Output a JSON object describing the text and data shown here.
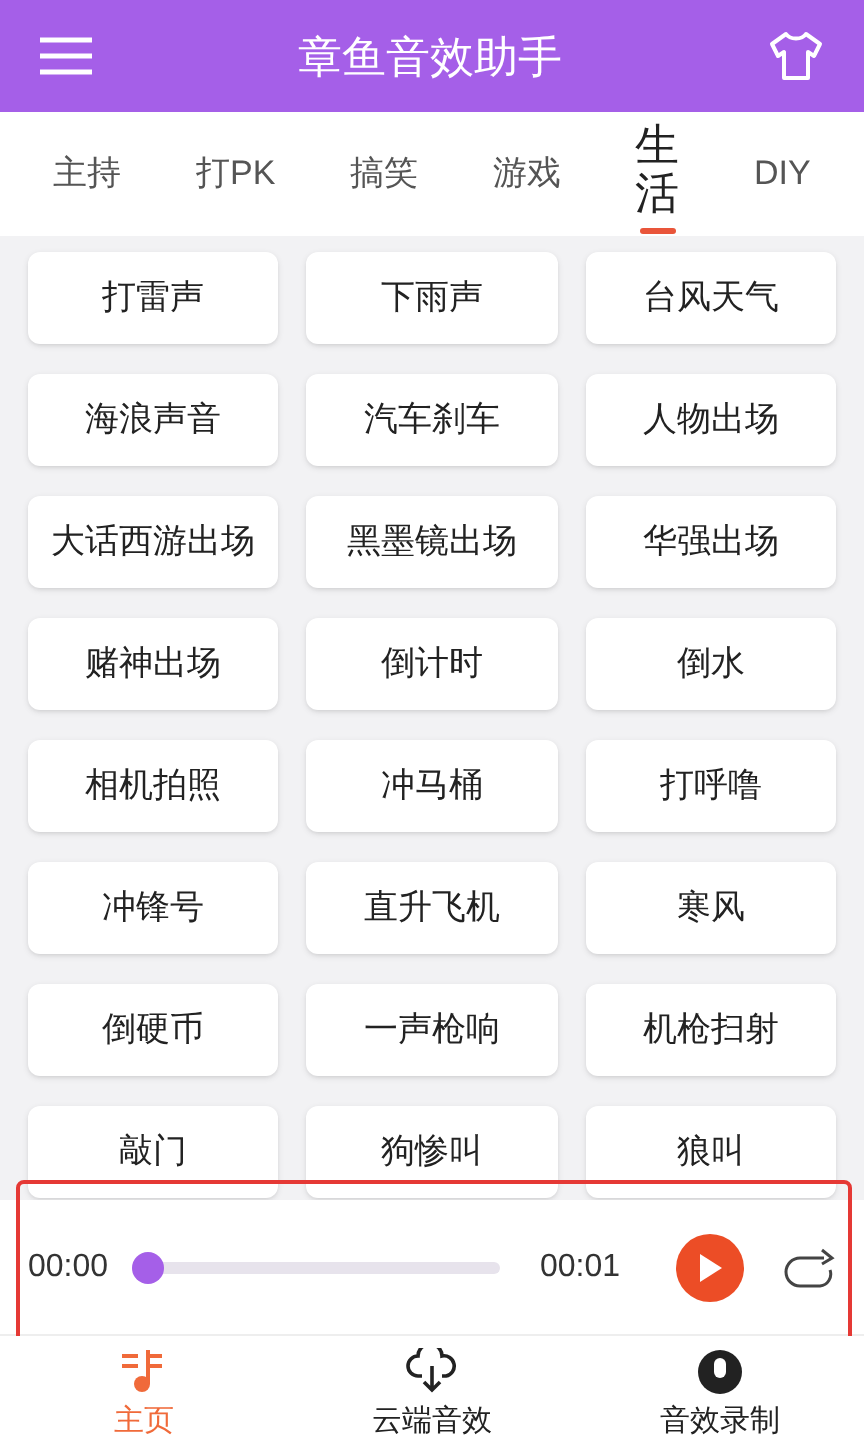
{
  "app_bar": {
    "title": "章鱼音效助手"
  },
  "tabs": [
    {
      "label": "主持",
      "selected": false
    },
    {
      "label": "打PK",
      "selected": false
    },
    {
      "label": "搞笑",
      "selected": false
    },
    {
      "label": "游戏",
      "selected": false
    },
    {
      "label": "生活",
      "selected": true
    },
    {
      "label": "DIY",
      "selected": false
    }
  ],
  "sounds": [
    "打雷声",
    "下雨声",
    "台风天气",
    "海浪声音",
    "汽车刹车",
    "人物出场",
    "大话西游出场",
    "黑墨镜出场",
    "华强出场",
    "赌神出场",
    "倒计时",
    "倒水",
    "相机拍照",
    "冲马桶",
    "打呼噜",
    "冲锋号",
    "直升飞机",
    "寒风",
    "倒硬币",
    "一声枪响",
    "机枪扫射",
    "敲门",
    "狗惨叫",
    "狼叫"
  ],
  "player": {
    "elapsed": "00:00",
    "duration": "00:01",
    "level": 0,
    "highlighted": true
  },
  "bottom_nav": [
    {
      "label": "主页",
      "selected": true,
      "kind": "home"
    },
    {
      "label": "云端音效",
      "selected": false,
      "kind": "cloud"
    },
    {
      "label": "音效录制",
      "selected": false,
      "kind": "record"
    }
  ]
}
